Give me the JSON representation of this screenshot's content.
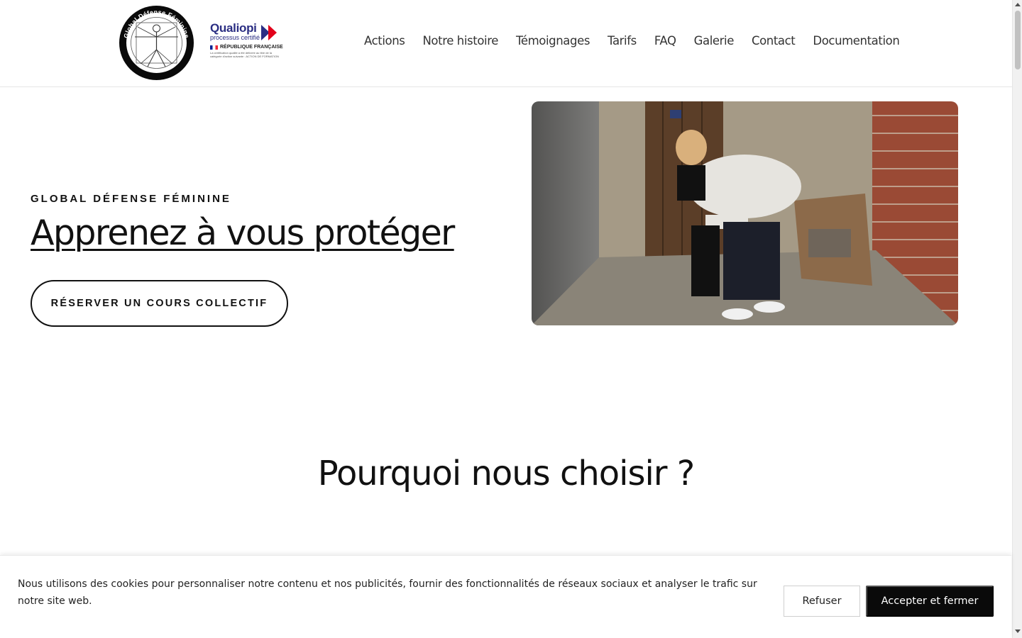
{
  "header": {
    "logo_ring_text": "Global Défense Féminine",
    "qualiopi": {
      "title": "Qualiopi",
      "subtitle": "processus certifié",
      "republic": "RÉPUBLIQUE FRANÇAISE",
      "small_text": "La certification qualité a été délivrée au titre de la catégorie d'action suivante : ACTION DE FORMATION"
    },
    "nav": [
      "Actions",
      "Notre histoire",
      "Témoignages",
      "Tarifs",
      "FAQ",
      "Galerie",
      "Contact",
      "Documentation"
    ]
  },
  "hero": {
    "eyebrow": "GLOBAL DÉFENSE FÉMININE",
    "title": "Apprenez à vous protéger",
    "cta_label": "RÉSERVER UN COURS COLLECTIF"
  },
  "section": {
    "title": "Pourquoi nous choisir ?"
  },
  "cookie": {
    "text": "Nous utilisons des cookies pour personnaliser notre contenu et nos publicités, fournir des fonctionnalités de réseaux sociaux et analyser le trafic sur notre site web.",
    "refuse_label": "Refuser",
    "accept_label": "Accepter et fermer"
  },
  "colors": {
    "qualiopi_blue": "#2b2e83",
    "qualiopi_red": "#e2001a",
    "accent_black": "#0a0a0a"
  }
}
